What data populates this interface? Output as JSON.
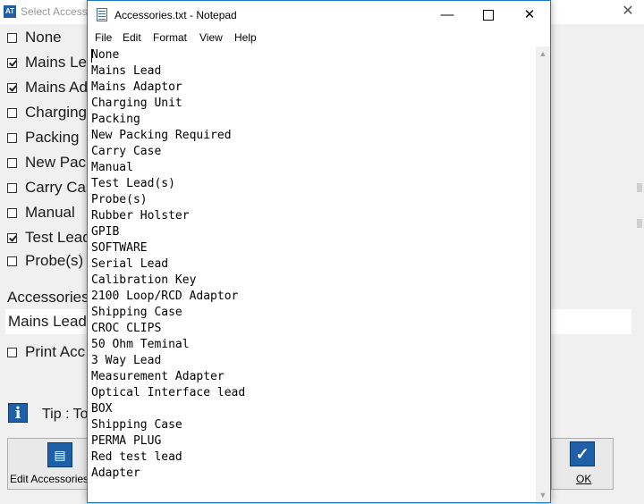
{
  "dialog": {
    "icon_text": "AT",
    "title": "Select Accesso",
    "close_glyph": "✕",
    "checkboxes": [
      {
        "label": "None",
        "checked": false
      },
      {
        "label": "Mains Le",
        "checked": true
      },
      {
        "label": "Mains Ad",
        "checked": true
      },
      {
        "label": "Charging",
        "checked": false
      },
      {
        "label": "Packing",
        "checked": false
      },
      {
        "label": "New Pack",
        "checked": false
      },
      {
        "label": "Carry Cas",
        "checked": false
      },
      {
        "label": "Manual",
        "checked": false
      },
      {
        "label": "Test Lead",
        "checked": true
      },
      {
        "label": "Probe(s)",
        "checked": false
      }
    ],
    "accessories_label": "Accessories",
    "accessories_value": "Mains Lead,",
    "print_label": "Print Acc",
    "print_checked": false,
    "tip_icon": "i",
    "tip_text": "Tip : To",
    "edit_button_label": "Edit Accessories",
    "ok_button_label": "OK",
    "edit_icon": "clipboard-add-icon",
    "ok_icon": "checkmark-icon"
  },
  "notepad": {
    "title": "Accessories.txt - Notepad",
    "minimize_glyph": "—",
    "close_glyph": "✕",
    "menu": [
      "File",
      "Edit",
      "Format",
      "View",
      "Help"
    ],
    "lines": [
      "None",
      "Mains Lead",
      "Mains Adaptor",
      "Charging Unit",
      "Packing",
      "New Packing Required",
      "Carry Case",
      "Manual",
      "Test Lead(s)",
      "Probe(s)",
      "Rubber Holster",
      "GPIB",
      "SOFTWARE",
      "Serial Lead",
      "Calibration Key",
      "2100 Loop/RCD Adaptor",
      "Shipping Case",
      "CROC CLIPS",
      "50 Ohm Teminal",
      "3 Way Lead",
      "Measurement Adapter",
      "Optical Interface lead",
      "BOX",
      "Shipping Case",
      "PERMA PLUG",
      "Red test lead",
      "Adapter"
    ]
  },
  "colors": {
    "accent_blue": "#1e5fa8",
    "window_border": "#1979ca"
  }
}
